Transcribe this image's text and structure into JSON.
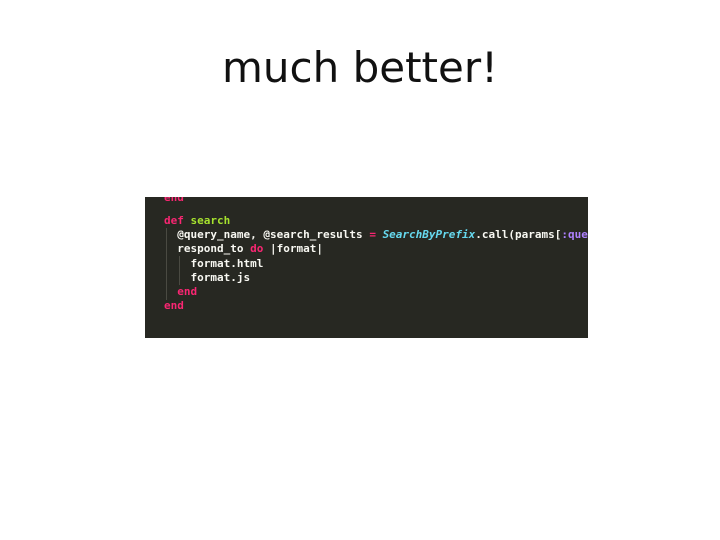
{
  "slide": {
    "title": "much better!"
  },
  "code": {
    "cut_top_line": "end",
    "lines": [
      {
        "tokens": [
          {
            "t": "def ",
            "c": "kw"
          },
          {
            "t": "search",
            "c": "fn"
          }
        ]
      },
      {
        "tokens": [
          {
            "t": "  @query_name, @search_results ",
            "c": "plain"
          },
          {
            "t": "=",
            "c": "op"
          },
          {
            "t": " ",
            "c": "plain"
          },
          {
            "t": "SearchByPrefix",
            "c": "cls"
          },
          {
            "t": ".call(params[",
            "c": "plain"
          },
          {
            "t": ":query",
            "c": "sym"
          },
          {
            "t": "])",
            "c": "plain"
          }
        ]
      },
      {
        "tokens": [
          {
            "t": "  respond_to ",
            "c": "plain"
          },
          {
            "t": "do",
            "c": "kw"
          },
          {
            "t": " |format|",
            "c": "plain"
          }
        ]
      },
      {
        "tokens": [
          {
            "t": "    format.html",
            "c": "plain"
          }
        ]
      },
      {
        "tokens": [
          {
            "t": "    format.js",
            "c": "plain"
          }
        ]
      },
      {
        "tokens": [
          {
            "t": "  ",
            "c": "plain"
          },
          {
            "t": "end",
            "c": "kw"
          }
        ]
      },
      {
        "tokens": [
          {
            "t": "end",
            "c": "kw"
          }
        ]
      }
    ]
  },
  "colors": {
    "editor_background": "#272822",
    "keyword": "#f92672",
    "function_name": "#a6e22e",
    "class_name": "#66d9ef",
    "symbol": "#ae81ff",
    "text": "#f8f8f2"
  }
}
